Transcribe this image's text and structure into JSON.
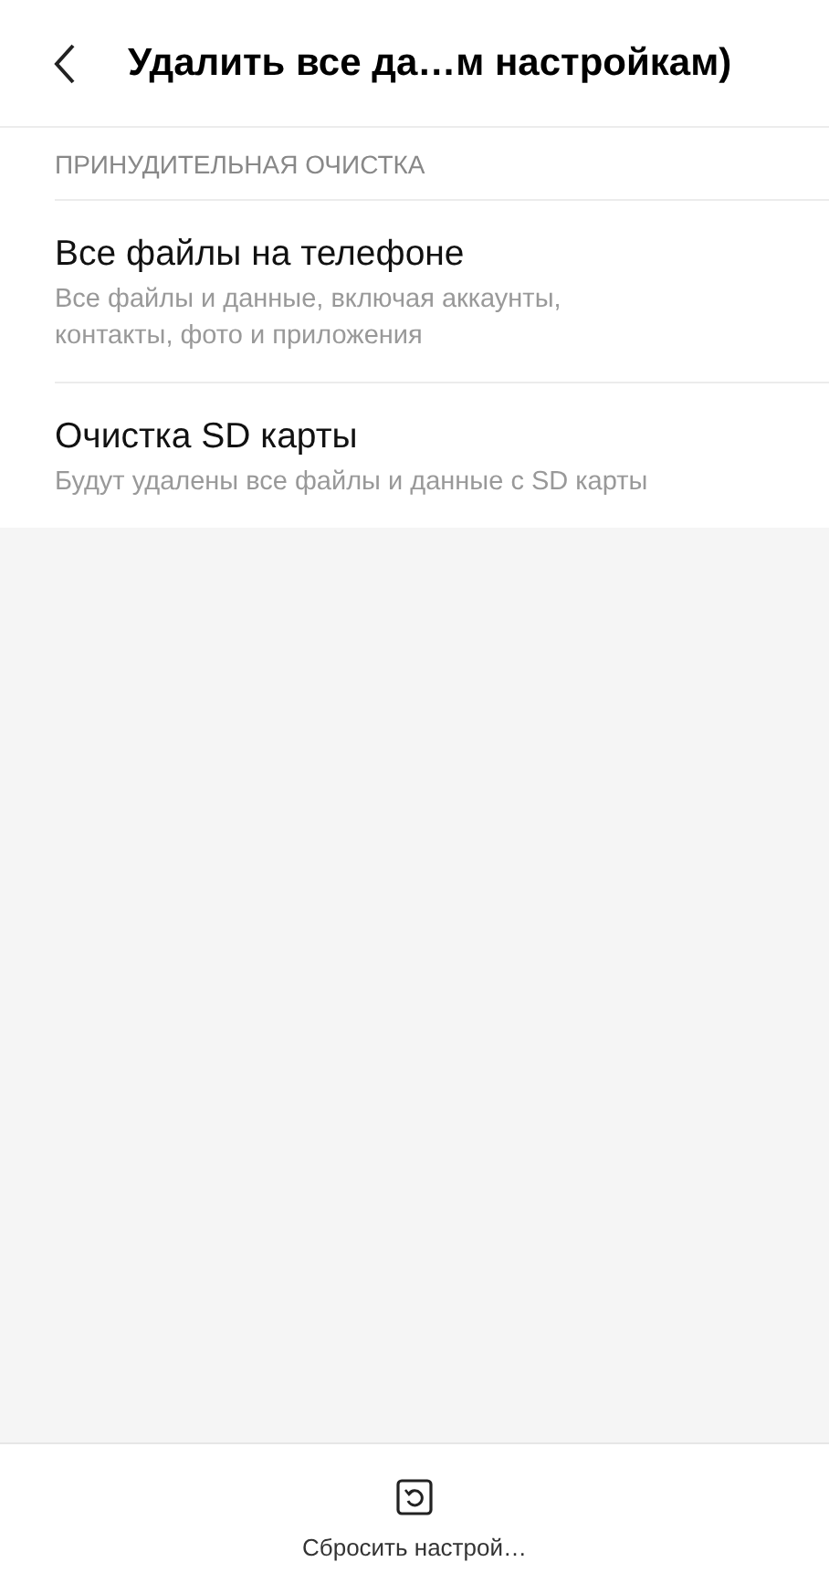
{
  "header": {
    "title": "Удалить все да…м настройкам)"
  },
  "section": {
    "title": "ПРИНУДИТЕЛЬНАЯ ОЧИСТКА",
    "items": [
      {
        "title": "Все файлы на телефоне",
        "subtitle": "Все файлы и данные, включая аккаунты, контакты, фото и приложения"
      },
      {
        "title": "Очистка SD карты",
        "subtitle": "Будут удалены все файлы и данные с SD карты"
      }
    ]
  },
  "bottom_bar": {
    "label": "Сбросить настрой…"
  }
}
